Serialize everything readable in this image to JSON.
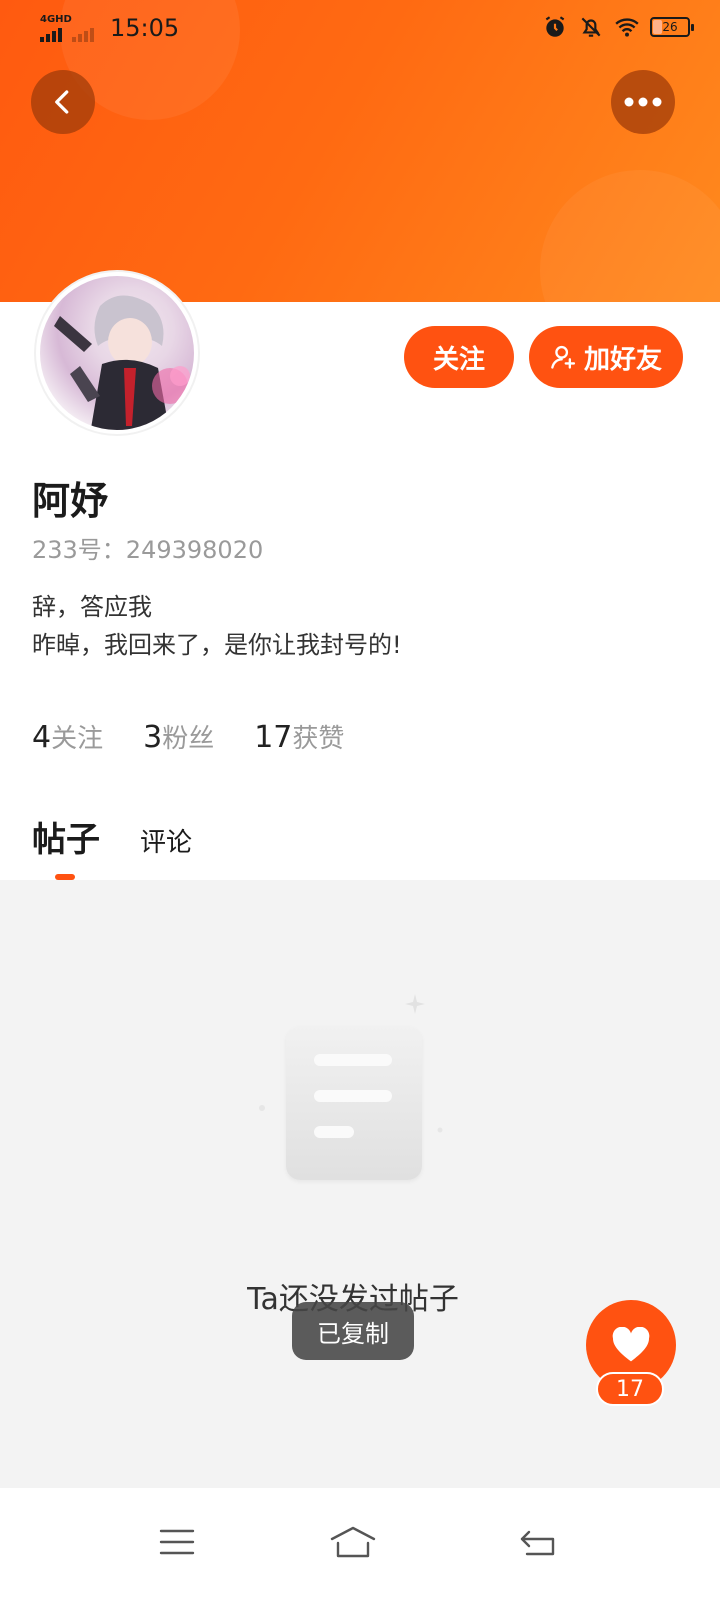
{
  "status_bar": {
    "network": "4GHD",
    "time": "15:05",
    "battery": "26"
  },
  "header": {
    "back_icon": "chevron-left-icon",
    "more_icon": "ellipsis-icon"
  },
  "profile": {
    "follow_label": "关注",
    "add_friend_label": "加好友",
    "nickname": "阿妤",
    "user_id": "233号：249398020",
    "bio_line1": "辞，答应我",
    "bio_line2": "昨晫，我回来了，是你让我封号的!"
  },
  "stats": {
    "following_count": "4",
    "following_label": "关注",
    "fans_count": "3",
    "fans_label": "粉丝",
    "likes_count": "17",
    "likes_label": "获赞"
  },
  "tabs": {
    "posts": "帖子",
    "comments": "评论"
  },
  "empty_state": {
    "message": "Ta还没发过帖子"
  },
  "toast": {
    "message": "已复制"
  },
  "like_fab": {
    "count": "17"
  },
  "colors": {
    "accent": "#ff5211",
    "banner_start": "#ff5a10",
    "banner_end": "#ff8a1e",
    "content_bg": "#f3f3f3"
  }
}
